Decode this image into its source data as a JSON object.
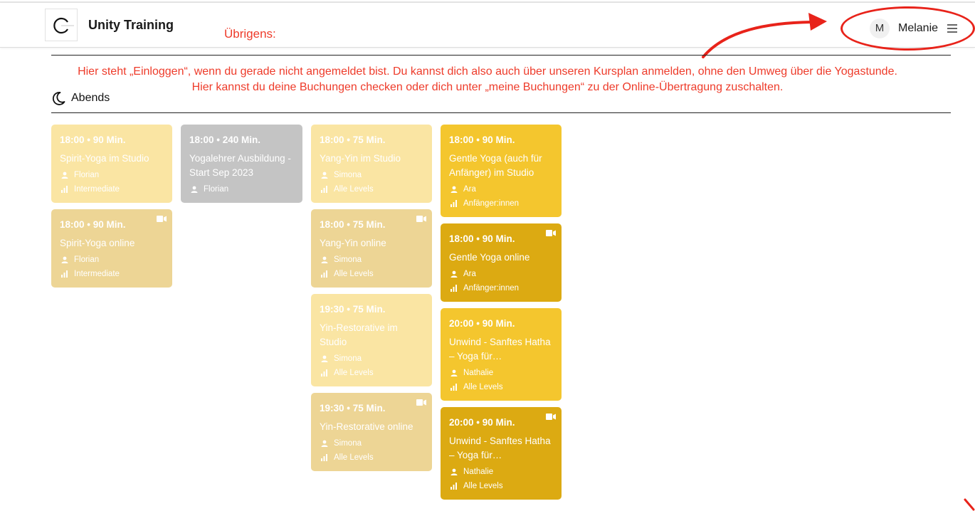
{
  "header": {
    "brand": "Unity Training",
    "user_initial": "M",
    "user_name": "Melanie"
  },
  "annotation": {
    "heading": "Übrigens:",
    "line1": "Hier steht „Einloggen“, wenn du gerade nicht angemeldet bist. Du kannst dich also auch über unseren Kursplan anmelden, ohne den Umweg über die Yogastunde.",
    "line2": "Hier kannst du deine Buchungen checken oder dich unter „meine Buchungen“ zu der Online-Übertragung zuschalten.",
    "color": "#ee3b2a"
  },
  "section": {
    "title": "Abends",
    "icon": "moon-icon"
  },
  "colors": {
    "pale": "#fae5a3",
    "pale_online": "#edd595",
    "gray": "#c4c4c4",
    "yellow": "#f4c62e",
    "yellow_dark": "#dcaa12"
  },
  "columns": [
    [
      {
        "time": "18:00 • 90 Min.",
        "title": "Spirit-Yoga im Studio",
        "teacher": "Florian",
        "level": "Intermediate",
        "online": false
      },
      {
        "time": "18:00 • 90 Min.",
        "title": "Spirit-Yoga online",
        "teacher": "Florian",
        "level": "Intermediate",
        "online": true
      }
    ],
    [
      {
        "time": "18:00 • 240 Min.",
        "title": "Yogalehrer Ausbildung - Start Sep 2023",
        "teacher": "Florian",
        "level": "",
        "online": false
      }
    ],
    [
      {
        "time": "18:00 • 75 Min.",
        "title": "Yang-Yin im Studio",
        "teacher": "Simona",
        "level": "Alle Levels",
        "online": false
      },
      {
        "time": "18:00 • 75 Min.",
        "title": "Yang-Yin online",
        "teacher": "Simona",
        "level": "Alle Levels",
        "online": true
      },
      {
        "time": "19:30 • 75 Min.",
        "title": "Yin-Restorative im Studio",
        "teacher": "Simona",
        "level": "Alle Levels",
        "online": false
      },
      {
        "time": "19:30 • 75 Min.",
        "title": "Yin-Restorative online",
        "teacher": "Simona",
        "level": "Alle Levels",
        "online": true
      }
    ],
    [
      {
        "time": "18:00 • 90 Min.",
        "title": "Gentle Yoga (auch für Anfänger) im Studio",
        "teacher": "Ara",
        "level": "Anfänger:innen",
        "online": false
      },
      {
        "time": "18:00 • 90 Min.",
        "title": "Gentle Yoga online",
        "teacher": "Ara",
        "level": "Anfänger:innen",
        "online": true
      },
      {
        "time": "20:00 • 90 Min.",
        "title": "Unwind - Sanftes Hatha – Yoga für…",
        "teacher": "Nathalie",
        "level": "Alle Levels",
        "online": false
      },
      {
        "time": "20:00 • 90 Min.",
        "title": "Unwind - Sanftes Hatha – Yoga für…",
        "teacher": "Nathalie",
        "level": "Alle Levels",
        "online": true
      }
    ]
  ]
}
